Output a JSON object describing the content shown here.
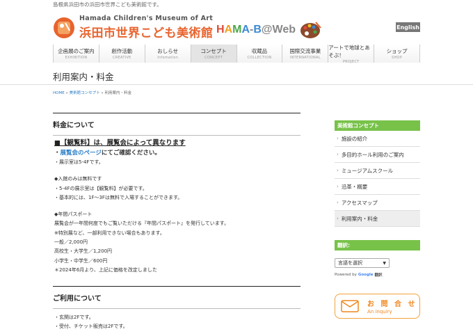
{
  "tagline": "島根県浜田市の浜田市世界こども美術館です。",
  "logo": {
    "en": "Hamada Children's Museum of Art",
    "ja": "浜田市世界こども美術館"
  },
  "hamab": {
    "letters": [
      "H",
      "A",
      "M",
      "A",
      "-",
      "B",
      "@",
      "W",
      "e",
      "b"
    ],
    "colors": [
      "#e04a3a",
      "#f0a020",
      "#4aa84a",
      "#3a8ad6",
      "#888888",
      "#3a8ad6",
      "#888888",
      "#888888",
      "#888888",
      "#888888"
    ]
  },
  "english_button": "English",
  "nav": [
    {
      "ja": "企画展のご案内",
      "en": "EXHIBITION"
    },
    {
      "ja": "創作活動",
      "en": "CREATIVE"
    },
    {
      "ja": "おしらせ",
      "en": "Infomation"
    },
    {
      "ja": "コンセプト",
      "en": "CONCEPT"
    },
    {
      "ja": "収蔵品",
      "en": "COLLECTION"
    },
    {
      "ja": "国際交流事業",
      "en": "INTERNATIONAL"
    },
    {
      "ja": "アートで地球とあそぶ！",
      "en": "PROJECT"
    },
    {
      "ja": "ショップ",
      "en": "SHOP"
    }
  ],
  "page_title": "利用案内・料金",
  "breadcrumb": {
    "home": "HOME",
    "sep1": " » ",
    "concept": "美術館コンセプト",
    "sep2": " » ",
    "current": "利用案内・料金"
  },
  "fees": {
    "heading": "料金について",
    "sub_head": "■【観覧料】は、展覧会によって異なります",
    "check_prefix": "・",
    "check_link": "展覧会のページ",
    "check_suffix": "にてご確認ください。",
    "floor": "・展示室は5-4Fです。",
    "entry_head": "◆入館のみは無料です",
    "entry_1": "・5-4Fの展示室は【観覧料】が必要です。",
    "entry_2": "・基本的には、1F～3Fは無料で入場することができます。",
    "pass_head": "◆年間パスポート",
    "pass_1": "展覧会が一年間何度でもご覧いただける『年間パスポート』を発行しています。",
    "pass_2": "※特別展など、一部利用できない場合もあります。",
    "price_general": "一般／2,000円",
    "price_high": "高校生・大学生／1,200円",
    "price_child": "小学生・中学生／600円",
    "price_note": "＊2024年6月より、上記に価格を改定しました"
  },
  "usage": {
    "heading": "ご利用について",
    "line_1": "・玄関は2Fです。",
    "line_2": "・受付、チケット販売は2Fです。"
  },
  "sidebar": {
    "concept_head": "美術館コンセプト",
    "items": [
      {
        "label": "施設の紹介",
        "active": false
      },
      {
        "label": "多目的ホール利用のご案内",
        "active": false
      },
      {
        "label": "ミュージアムスクール",
        "active": false
      },
      {
        "label": "沿革・概要",
        "active": false
      },
      {
        "label": "アクセスマップ",
        "active": false
      },
      {
        "label": "利用案内・料金",
        "active": true
      }
    ],
    "translate_head": "翻訳:",
    "select_value": "言語を選択",
    "powered_by": "Powered by",
    "google": "Google",
    "translate_word": "翻訳",
    "inquiry_ja": "お 問 合 せ",
    "inquiry_en": "An inquiry"
  }
}
